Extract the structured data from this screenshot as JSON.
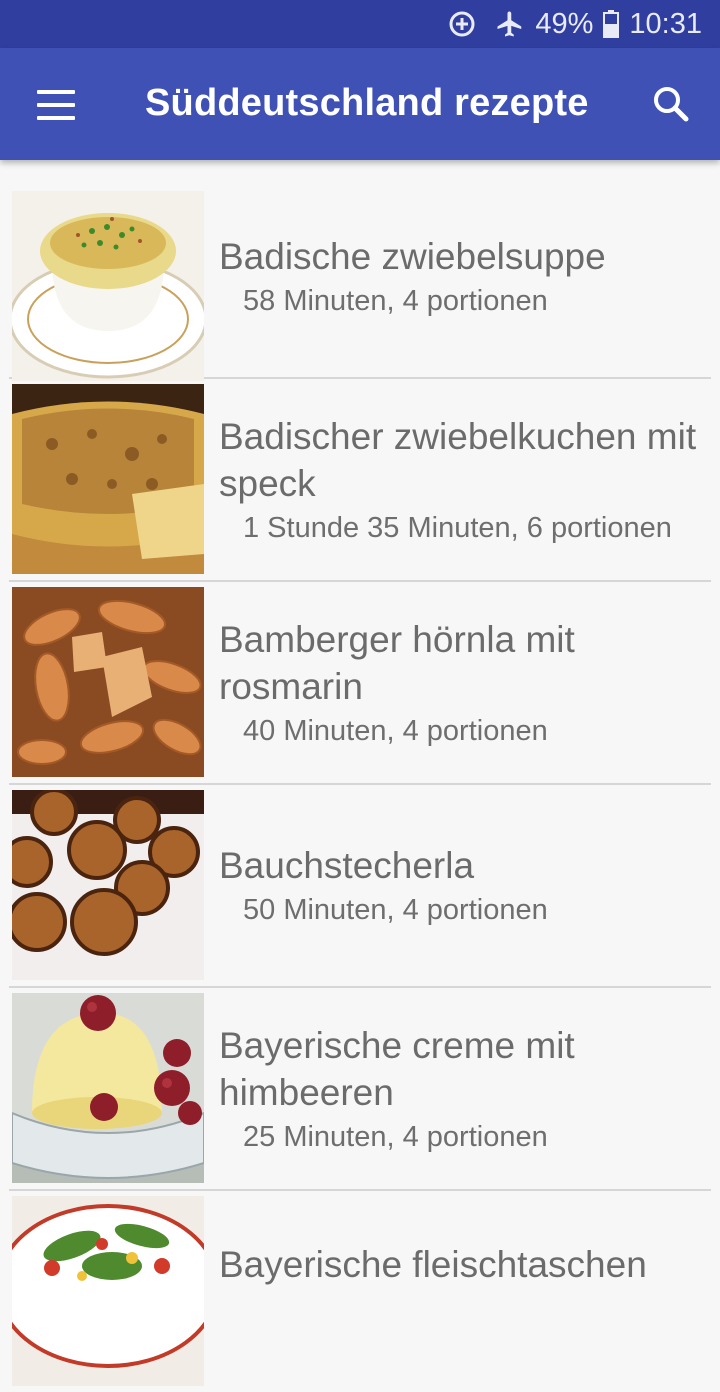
{
  "status_bar": {
    "battery_percent": "49%",
    "time": "10:31",
    "icons": [
      "data-saver-icon",
      "airplane-mode-icon",
      "battery-icon"
    ]
  },
  "app_bar": {
    "title": "Süddeutschland rezepte",
    "menu_icon": "hamburger-menu-icon",
    "search_icon": "search-icon"
  },
  "recipes": [
    {
      "title": "Badische zwiebelsuppe",
      "meta": "58 Minuten, 4 portionen",
      "image": "onion-soup-photo"
    },
    {
      "title": "Badischer zwiebelkuchen mit speck",
      "meta": "1 Stunde 35 Minuten, 6 portionen",
      "image": "onion-tart-photo"
    },
    {
      "title": "Bamberger hörnla mit rosmarin",
      "meta": "40 Minuten, 4 portionen",
      "image": "roasted-potatoes-photo"
    },
    {
      "title": "Bauchstecherla",
      "meta": "50 Minuten, 4 portionen",
      "image": "potato-patties-photo"
    },
    {
      "title": "Bayerische creme mit himbeeren",
      "meta": "25 Minuten, 4 portionen",
      "image": "bavarian-cream-photo"
    },
    {
      "title": "Bayerische fleischtaschen",
      "meta": "",
      "image": "salad-plate-photo"
    }
  ]
}
